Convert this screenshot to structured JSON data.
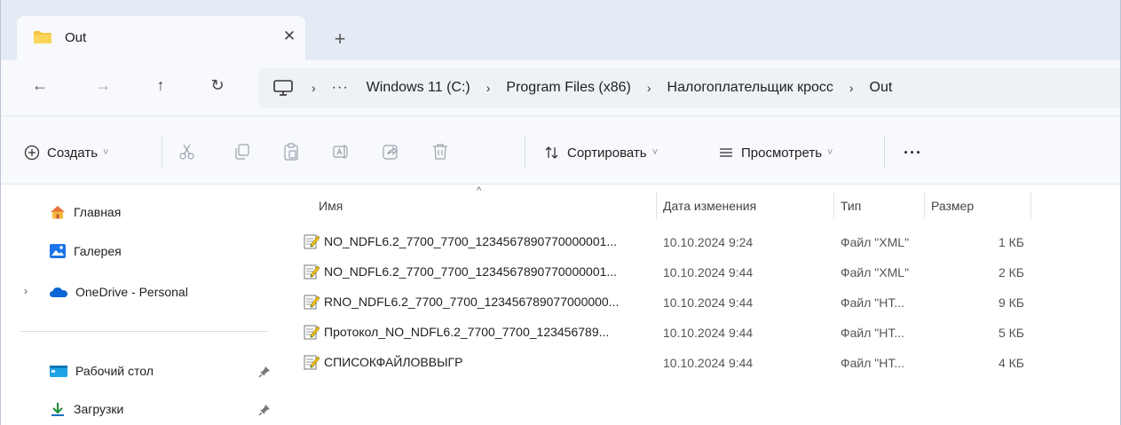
{
  "tab": {
    "title": "Out",
    "close_glyph": "✕",
    "new_glyph": "+"
  },
  "nav": {
    "back_glyph": "←",
    "forward_glyph": "→",
    "up_glyph": "↑",
    "refresh_glyph": "↻"
  },
  "breadcrumb": {
    "overflow": "···",
    "separator": "›",
    "items": [
      "Windows 11 (C:)",
      "Program Files (x86)",
      "Налогоплательщик кросс",
      "Out"
    ]
  },
  "toolbar": {
    "create_label": "Создать",
    "sort_label": "Сортировать",
    "view_label": "Просмотреть",
    "more_glyph": "···",
    "chevron": "˅"
  },
  "sidebar": {
    "items": [
      {
        "label": "Главная"
      },
      {
        "label": "Галерея"
      },
      {
        "label": "OneDrive - Personal",
        "expand_glyph": "›"
      },
      {
        "label": "Рабочий стол",
        "pinned": true
      },
      {
        "label": "Загрузки",
        "pinned": true
      }
    ]
  },
  "columns": {
    "name": "Имя",
    "date": "Дата изменения",
    "type": "Тип",
    "size": "Размер",
    "sort_glyph": "^"
  },
  "files": [
    {
      "name": "NO_NDFL6.2_7700_7700_1234567890770000001...",
      "date": "10.10.2024 9:24",
      "type": "Файл \"XML\"",
      "size": "1 КБ"
    },
    {
      "name": "NO_NDFL6.2_7700_7700_1234567890770000001...",
      "date": "10.10.2024 9:44",
      "type": "Файл \"XML\"",
      "size": "2 КБ"
    },
    {
      "name": "RNO_NDFL6.2_7700_7700_123456789077000000...",
      "date": "10.10.2024 9:44",
      "type": "Файл \"HT...",
      "size": "9 КБ"
    },
    {
      "name": "Протокол_NO_NDFL6.2_7700_7700_123456789...",
      "date": "10.10.2024 9:44",
      "type": "Файл \"HT...",
      "size": "5 КБ"
    },
    {
      "name": "СПИСОКФАЙЛОВВЫГР",
      "date": "10.10.2024 9:44",
      "type": "Файл \"HT...",
      "size": "4 КБ"
    }
  ],
  "colors": {
    "tabstrip_bg": "#e4ebf4",
    "toolbar_bg": "#f7f9fc",
    "folder_yellow": "#f4c542",
    "onedrive_blue": "#0a64d6",
    "accent": "#0067c0"
  }
}
